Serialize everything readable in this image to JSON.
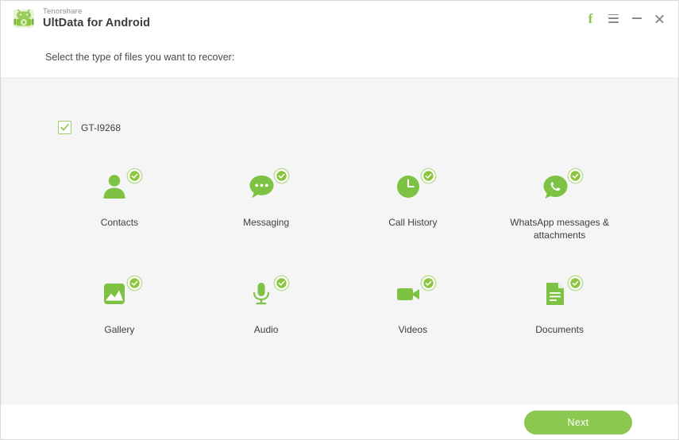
{
  "window": {
    "brand_sub": "Tenorshare",
    "brand_main": "UltData for Android",
    "logo_icon": "android-robot-icon",
    "controls": [
      {
        "name": "facebook-button",
        "label": "f",
        "icon": "facebook-icon"
      },
      {
        "name": "menu-button",
        "label": "",
        "icon": "hamburger-menu-icon"
      },
      {
        "name": "minimize-button",
        "label": "",
        "icon": "minimize-icon"
      },
      {
        "name": "close-button",
        "label": "",
        "icon": "close-icon"
      }
    ]
  },
  "subheader": {
    "instruction": "Select the type of files you want to recover:"
  },
  "device": {
    "name": "GT-I9268",
    "checked": true,
    "checkbox_icon": "checkmark-icon"
  },
  "file_types": [
    {
      "label": "Contacts",
      "icon": "contacts-person-icon",
      "selected": true
    },
    {
      "label": "Messaging",
      "icon": "messaging-bubble-icon",
      "selected": true
    },
    {
      "label": "Call History",
      "icon": "call-history-clock-icon",
      "selected": true
    },
    {
      "label": "WhatsApp messages & attachments",
      "icon": "whatsapp-icon",
      "selected": true
    },
    {
      "label": "Gallery",
      "icon": "gallery-image-icon",
      "selected": true
    },
    {
      "label": "Audio",
      "icon": "audio-microphone-icon",
      "selected": true
    },
    {
      "label": "Videos",
      "icon": "videos-camera-icon",
      "selected": true
    },
    {
      "label": "Documents",
      "icon": "documents-page-icon",
      "selected": true
    }
  ],
  "footer": {
    "next_label": "Next"
  },
  "colors": {
    "brand_green": "#8cc63f",
    "button_green": "#8cc751",
    "icon_green": "#7dc242",
    "panel_gray": "#f5f5f5",
    "text_dark": "#3f3f3f"
  }
}
